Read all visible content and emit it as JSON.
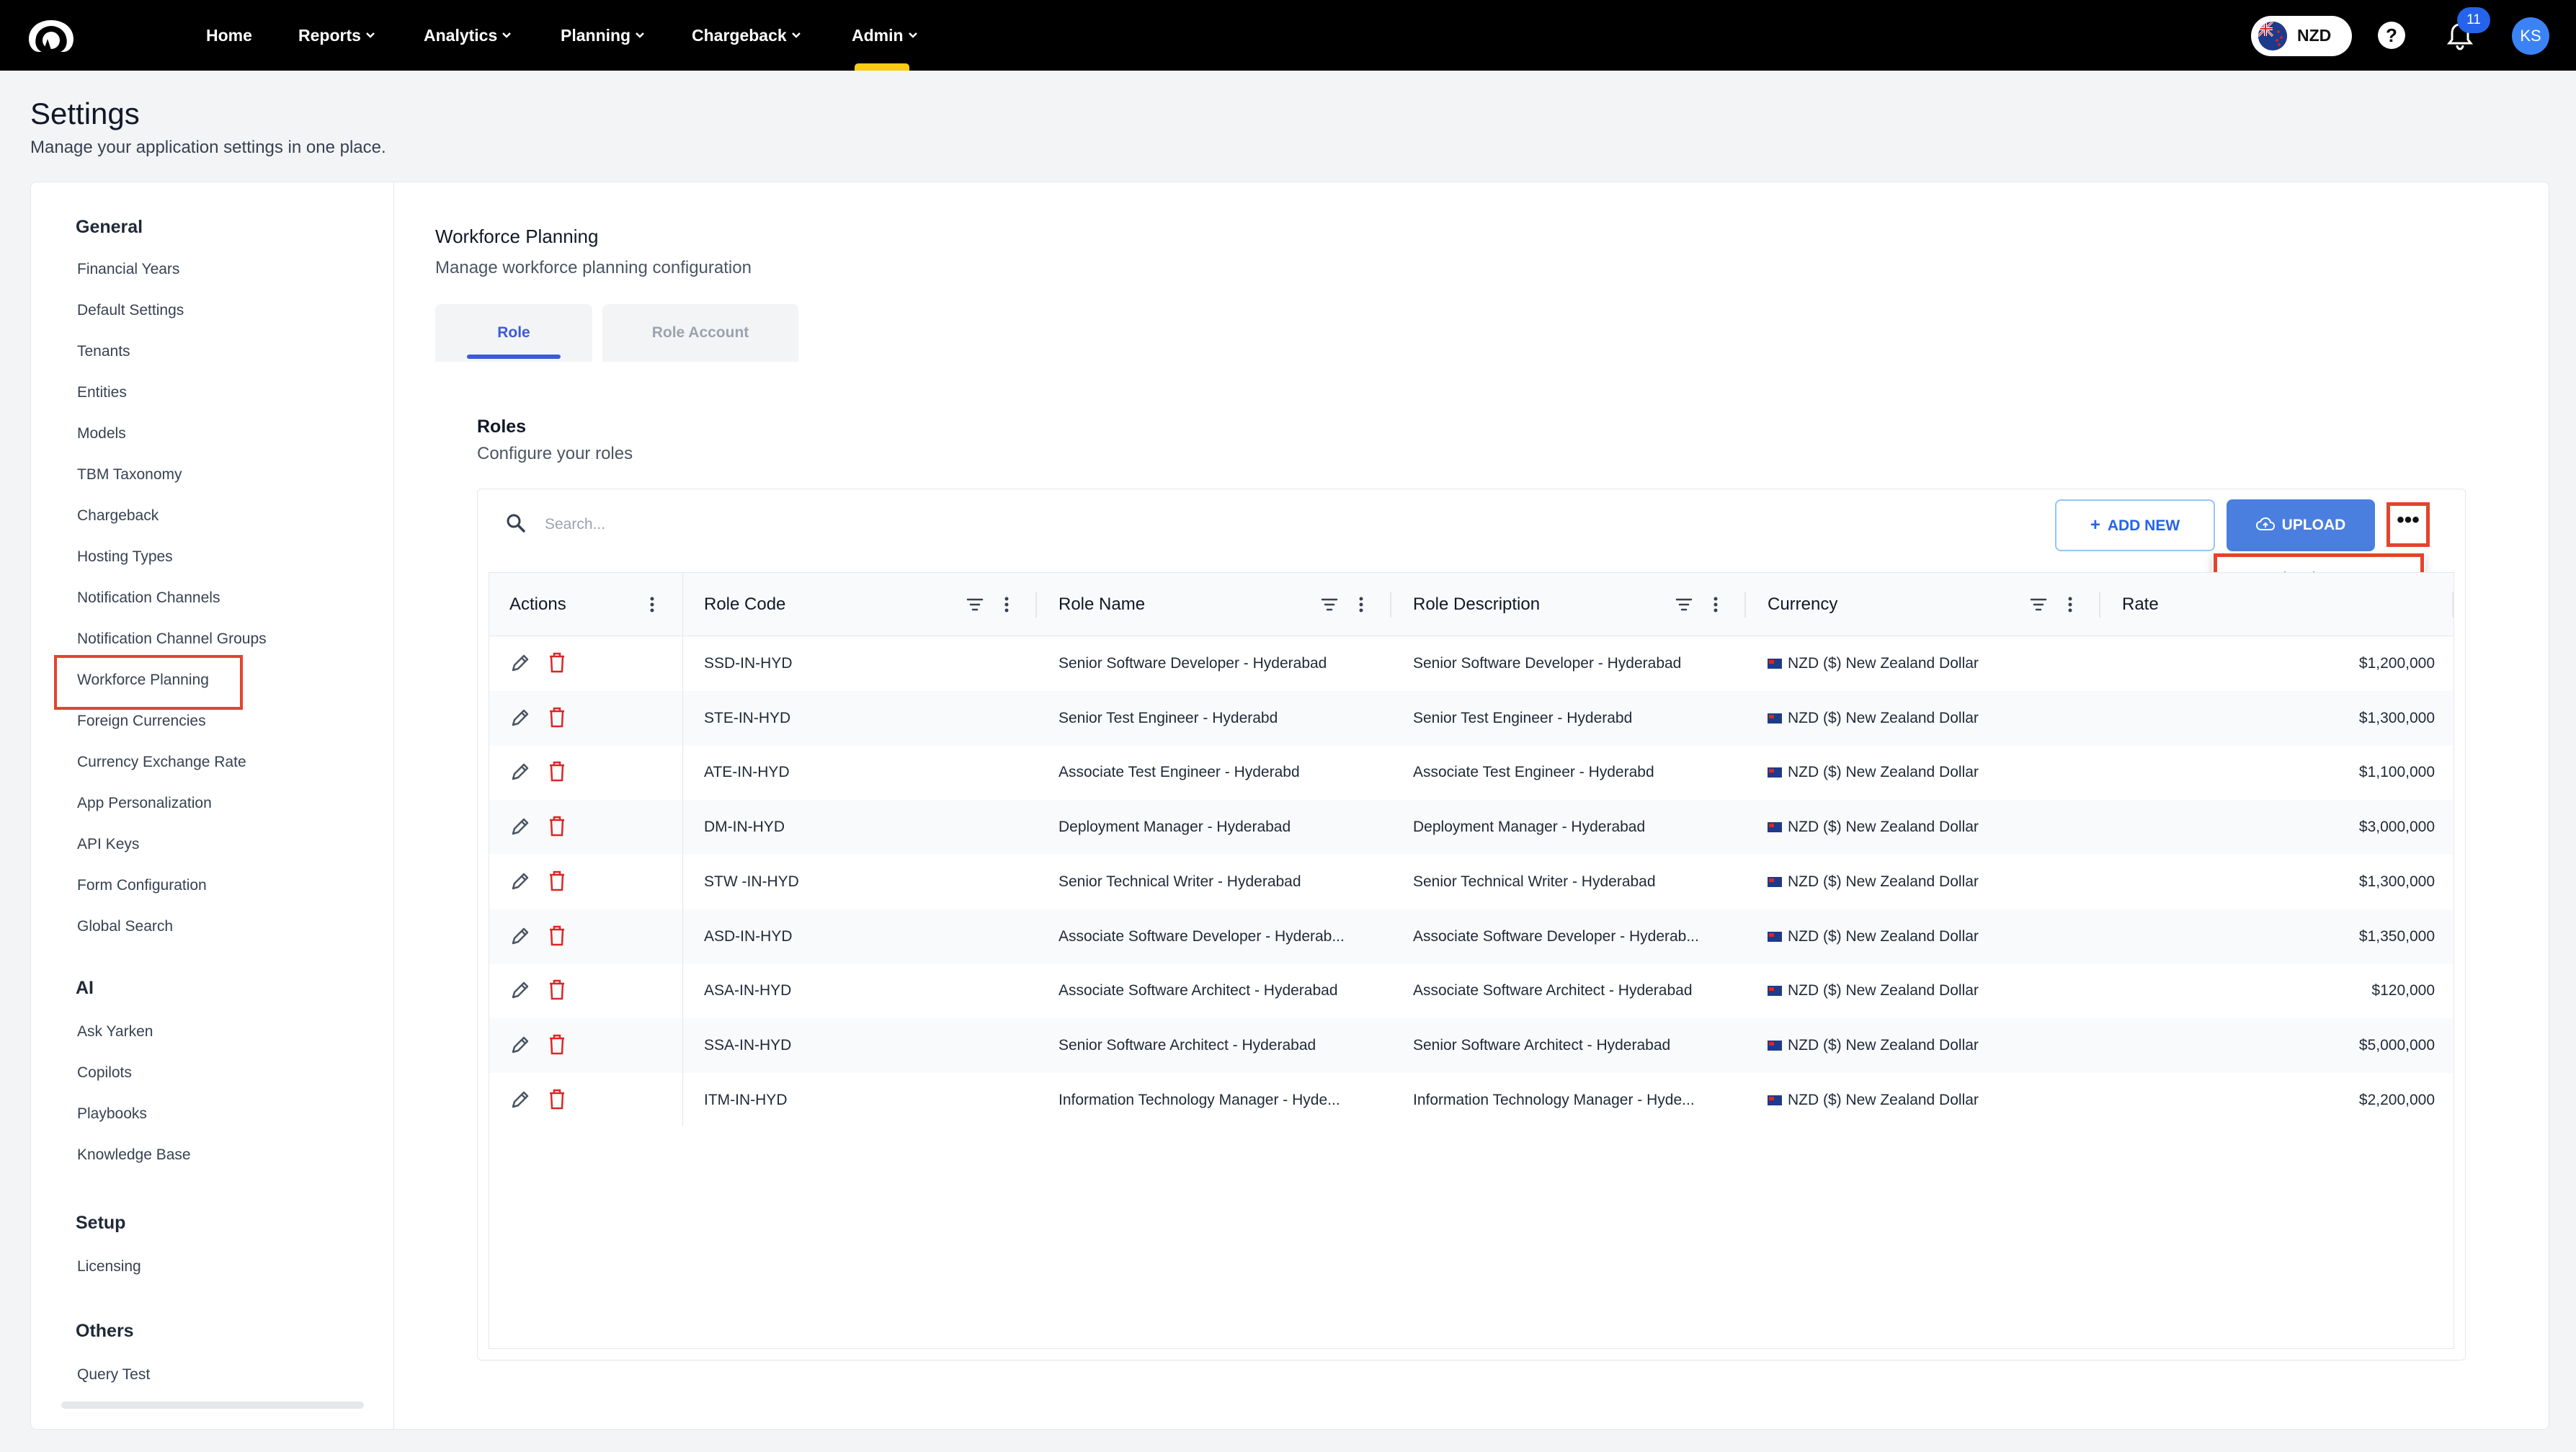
{
  "nav": {
    "items": [
      {
        "label": "Home",
        "has_menu": false
      },
      {
        "label": "Reports",
        "has_menu": true
      },
      {
        "label": "Analytics",
        "has_menu": true
      },
      {
        "label": "Planning",
        "has_menu": true
      },
      {
        "label": "Chargeback",
        "has_menu": true
      },
      {
        "label": "Admin",
        "has_menu": true,
        "active": true
      }
    ],
    "currency": "NZD",
    "notification_count": "11",
    "user_initials": "KS",
    "active_color": "#facc15"
  },
  "page": {
    "title": "Settings",
    "subtitle": "Manage your application settings in one place."
  },
  "sidebar": {
    "sections": [
      {
        "title": "General",
        "items": [
          "Financial Years",
          "Default Settings",
          "Tenants",
          "Entities",
          "Models",
          "TBM Taxonomy",
          "Chargeback",
          "Hosting Types",
          "Notification Channels",
          "Notification Channel Groups",
          "Workforce Planning",
          "Foreign Currencies",
          "Currency Exchange Rate",
          "App Personalization",
          "API Keys",
          "Form Configuration",
          "Global Search"
        ]
      },
      {
        "title": "AI",
        "items": [
          "Ask Yarken",
          "Copilots",
          "Playbooks",
          "Knowledge Base"
        ]
      },
      {
        "title": "Setup",
        "items": [
          "Licensing"
        ]
      },
      {
        "title": "Others",
        "items": [
          "Query Test"
        ]
      }
    ],
    "selected": "Workforce Planning"
  },
  "content": {
    "title": "Workforce Planning",
    "subtitle": "Manage workforce planning configuration",
    "tabs": [
      {
        "label": "Role",
        "active": true
      },
      {
        "label": "Role Account",
        "active": false
      }
    ]
  },
  "roles": {
    "title": "Roles",
    "subtitle": "Configure your roles",
    "search_placeholder": "Search...",
    "add_new_label": "ADD NEW",
    "upload_label": "UPLOAD",
    "more_label": "•••",
    "menu": {
      "download_label": "Download"
    },
    "columns": [
      "Actions",
      "Role Code",
      "Role Name",
      "Role Description",
      "Currency",
      "Rate"
    ],
    "rows": [
      {
        "code": "SSD-IN-HYD",
        "name": "Senior Software Developer - Hyderabad",
        "description": "Senior Software Developer - Hyderabad",
        "currency": "NZD ($) New Zealand Dollar",
        "rate": "$1,200,000"
      },
      {
        "code": "STE-IN-HYD",
        "name": "Senior Test Engineer - Hyderabd",
        "description": "Senior Test Engineer - Hyderabd",
        "currency": "NZD ($) New Zealand Dollar",
        "rate": "$1,300,000"
      },
      {
        "code": "ATE-IN-HYD",
        "name": "Associate Test Engineer - Hyderabd",
        "description": "Associate Test Engineer - Hyderabd",
        "currency": "NZD ($) New Zealand Dollar",
        "rate": "$1,100,000"
      },
      {
        "code": "DM-IN-HYD",
        "name": "Deployment Manager - Hyderabad",
        "description": "Deployment Manager - Hyderabad",
        "currency": "NZD ($) New Zealand Dollar",
        "rate": "$3,000,000"
      },
      {
        "code": "STW -IN-HYD",
        "name": "Senior Technical Writer - Hyderabad",
        "description": "Senior Technical Writer - Hyderabad",
        "currency": "NZD ($) New Zealand Dollar",
        "rate": "$1,300,000"
      },
      {
        "code": "ASD-IN-HYD",
        "name": "Associate Software Developer - Hyderab...",
        "description": "Associate Software Developer - Hyderab...",
        "currency": "NZD ($) New Zealand Dollar",
        "rate": "$1,350,000"
      },
      {
        "code": "ASA-IN-HYD",
        "name": "Associate Software Architect - Hyderabad",
        "description": "Associate Software Architect - Hyderabad",
        "currency": "NZD ($) New Zealand Dollar",
        "rate": "$120,000"
      },
      {
        "code": "SSA-IN-HYD",
        "name": "Senior Software Architect - Hyderabad",
        "description": "Senior Software Architect - Hyderabad",
        "currency": "NZD ($) New Zealand Dollar",
        "rate": "$5,000,000"
      },
      {
        "code": "ITM-IN-HYD",
        "name": "Information Technology Manager - Hyde...",
        "description": "Information Technology Manager - Hyde...",
        "currency": "NZD ($) New Zealand Dollar",
        "rate": "$2,200,000"
      }
    ]
  },
  "colors": {
    "accent": "#3b5bdb",
    "highlight_box": "#e4432d",
    "upload_button": "#4a7fe0",
    "delete_icon": "#dc2626"
  },
  "icons": [
    "logo-icon",
    "chevron-down-icon",
    "flag-icon",
    "help-icon",
    "bell-icon",
    "search-icon",
    "plus-icon",
    "cloud-upload-icon",
    "more-icon",
    "filter-icon",
    "kebab-icon",
    "edit-icon",
    "delete-icon"
  ]
}
